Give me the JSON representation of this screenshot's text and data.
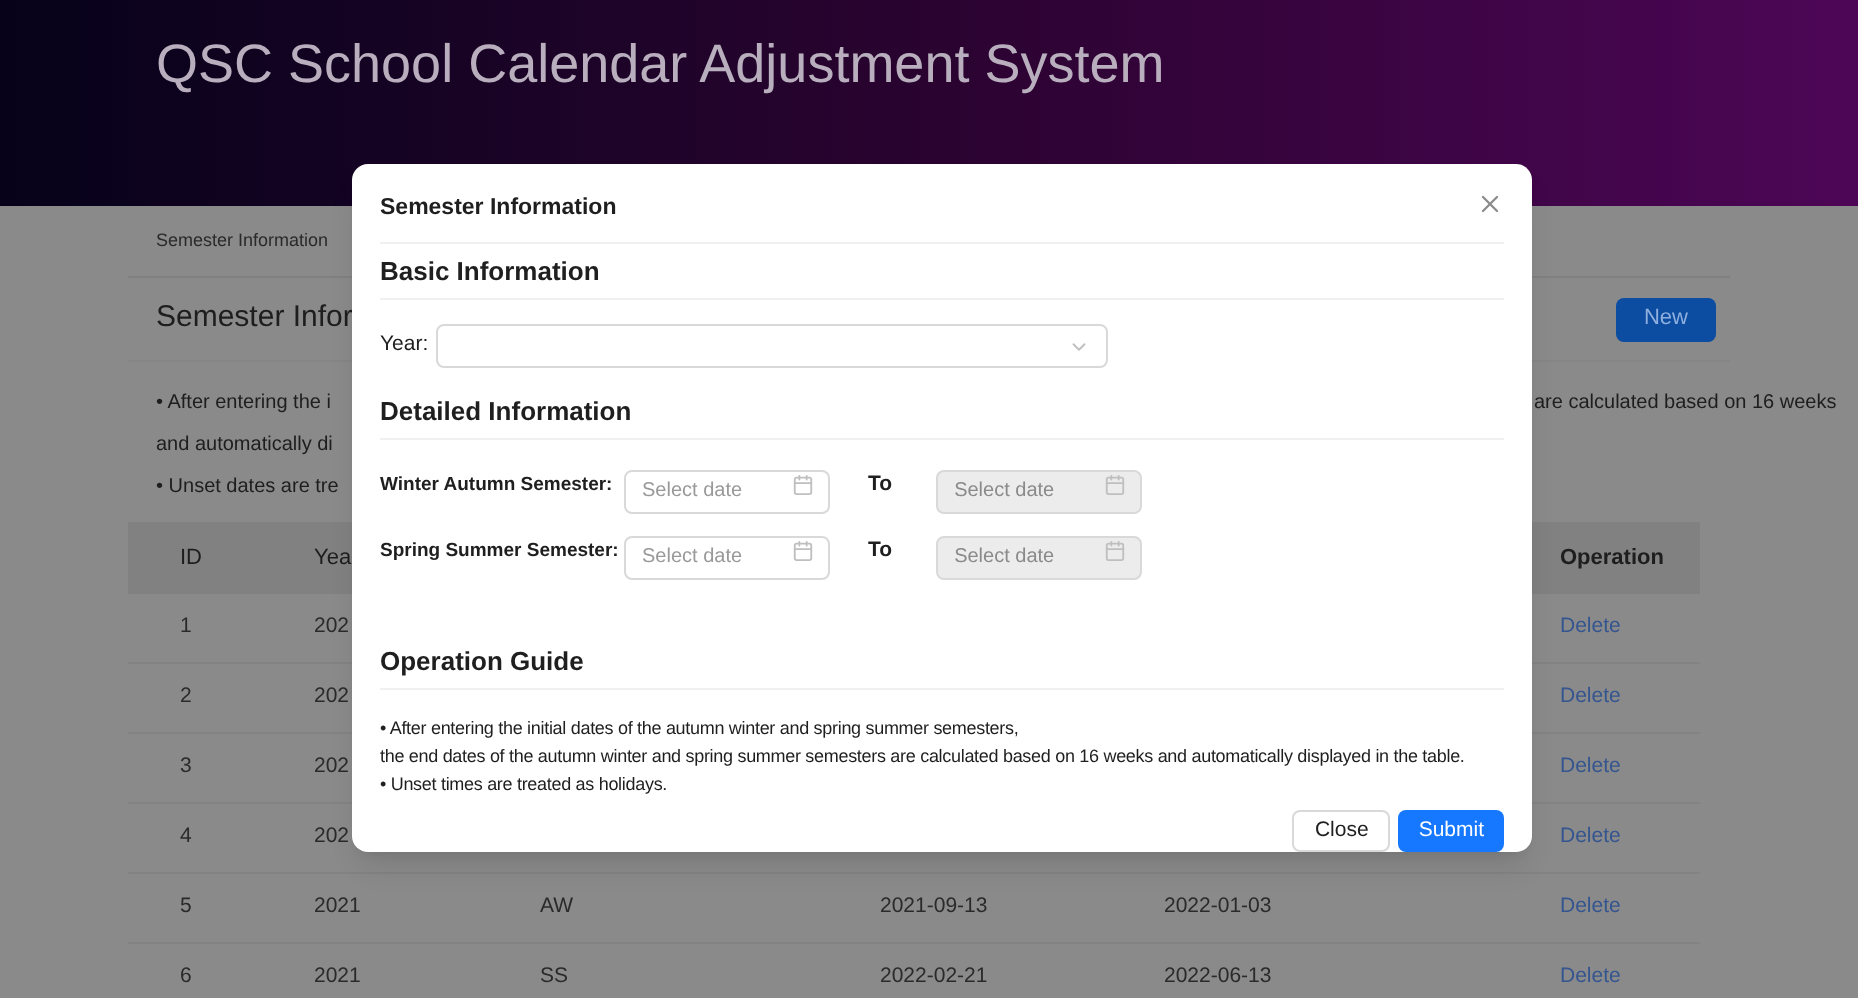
{
  "header": {
    "title": "QSC School Calendar Adjustment System"
  },
  "breadcrumb": "Semester Information",
  "page": {
    "title": "Semester Infor",
    "new_button": "New",
    "note_right": "are calculated based on 16 weeks",
    "notes_left": [
      "• After entering the i",
      "and automatically di",
      "• Unset dates are tre"
    ]
  },
  "table": {
    "header": {
      "id": "ID",
      "year": "Yea",
      "operation": "Operation"
    },
    "rows": [
      {
        "id": "1",
        "year": "202",
        "action": "Delete"
      },
      {
        "id": "2",
        "year": "202",
        "action": "Delete"
      },
      {
        "id": "3",
        "year": "202",
        "action": "Delete"
      },
      {
        "id": "4",
        "year": "202",
        "action": "Delete"
      },
      {
        "id": "5",
        "year": "2021",
        "semester": "AW",
        "start": "2021-09-13",
        "end": "2022-01-03",
        "action": "Delete"
      },
      {
        "id": "6",
        "year": "2021",
        "semester": "SS",
        "start": "2022-02-21",
        "end": "2022-06-13",
        "action": "Delete"
      }
    ]
  },
  "dialog": {
    "title": "Semester Information",
    "basic": {
      "heading": "Basic Information",
      "year_label": "Year:"
    },
    "detailed": {
      "heading": "Detailed Information",
      "rows": [
        {
          "label": "Winter Autumn Semester:",
          "start": {
            "placeholder": "Select date",
            "disabled": false
          },
          "to": "To",
          "end": {
            "placeholder": "Select date",
            "disabled": true
          }
        },
        {
          "label": "Spring Summer Semester:",
          "start": {
            "placeholder": "Select date",
            "disabled": false
          },
          "to": "To",
          "end": {
            "placeholder": "Select date",
            "disabled": true
          }
        }
      ]
    },
    "guide": {
      "heading": "Operation Guide",
      "lines": [
        "• After entering the initial dates of the autumn winter and spring summer semesters,",
        "the end dates of the autumn winter and spring summer semesters are calculated based on 16 weeks and automatically displayed in the table.",
        "• Unset times are treated as holidays."
      ]
    },
    "buttons": [
      {
        "label": "Close",
        "kind": "default"
      },
      {
        "label": "Submit",
        "kind": "primary"
      }
    ]
  }
}
